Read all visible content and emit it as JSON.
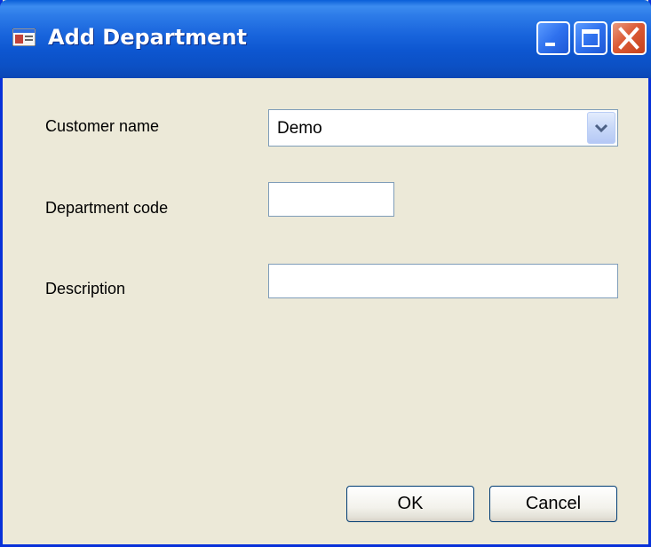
{
  "window": {
    "title": "Add Department",
    "controls": {
      "minimize": "minimize-icon",
      "maximize": "maximize-icon",
      "close": "close-icon"
    },
    "colors": {
      "titlebar": "#0c50c4",
      "frame": "#0831d9",
      "background": "#ece9d8",
      "close_button": "#dc5b36"
    }
  },
  "form": {
    "customer_name_label": "Customer name",
    "customer_name_value": "Demo",
    "department_code_label": "Department code",
    "department_code_value": "",
    "description_label": "Description",
    "description_value": ""
  },
  "buttons": {
    "ok_label": "OK",
    "cancel_label": "Cancel"
  }
}
